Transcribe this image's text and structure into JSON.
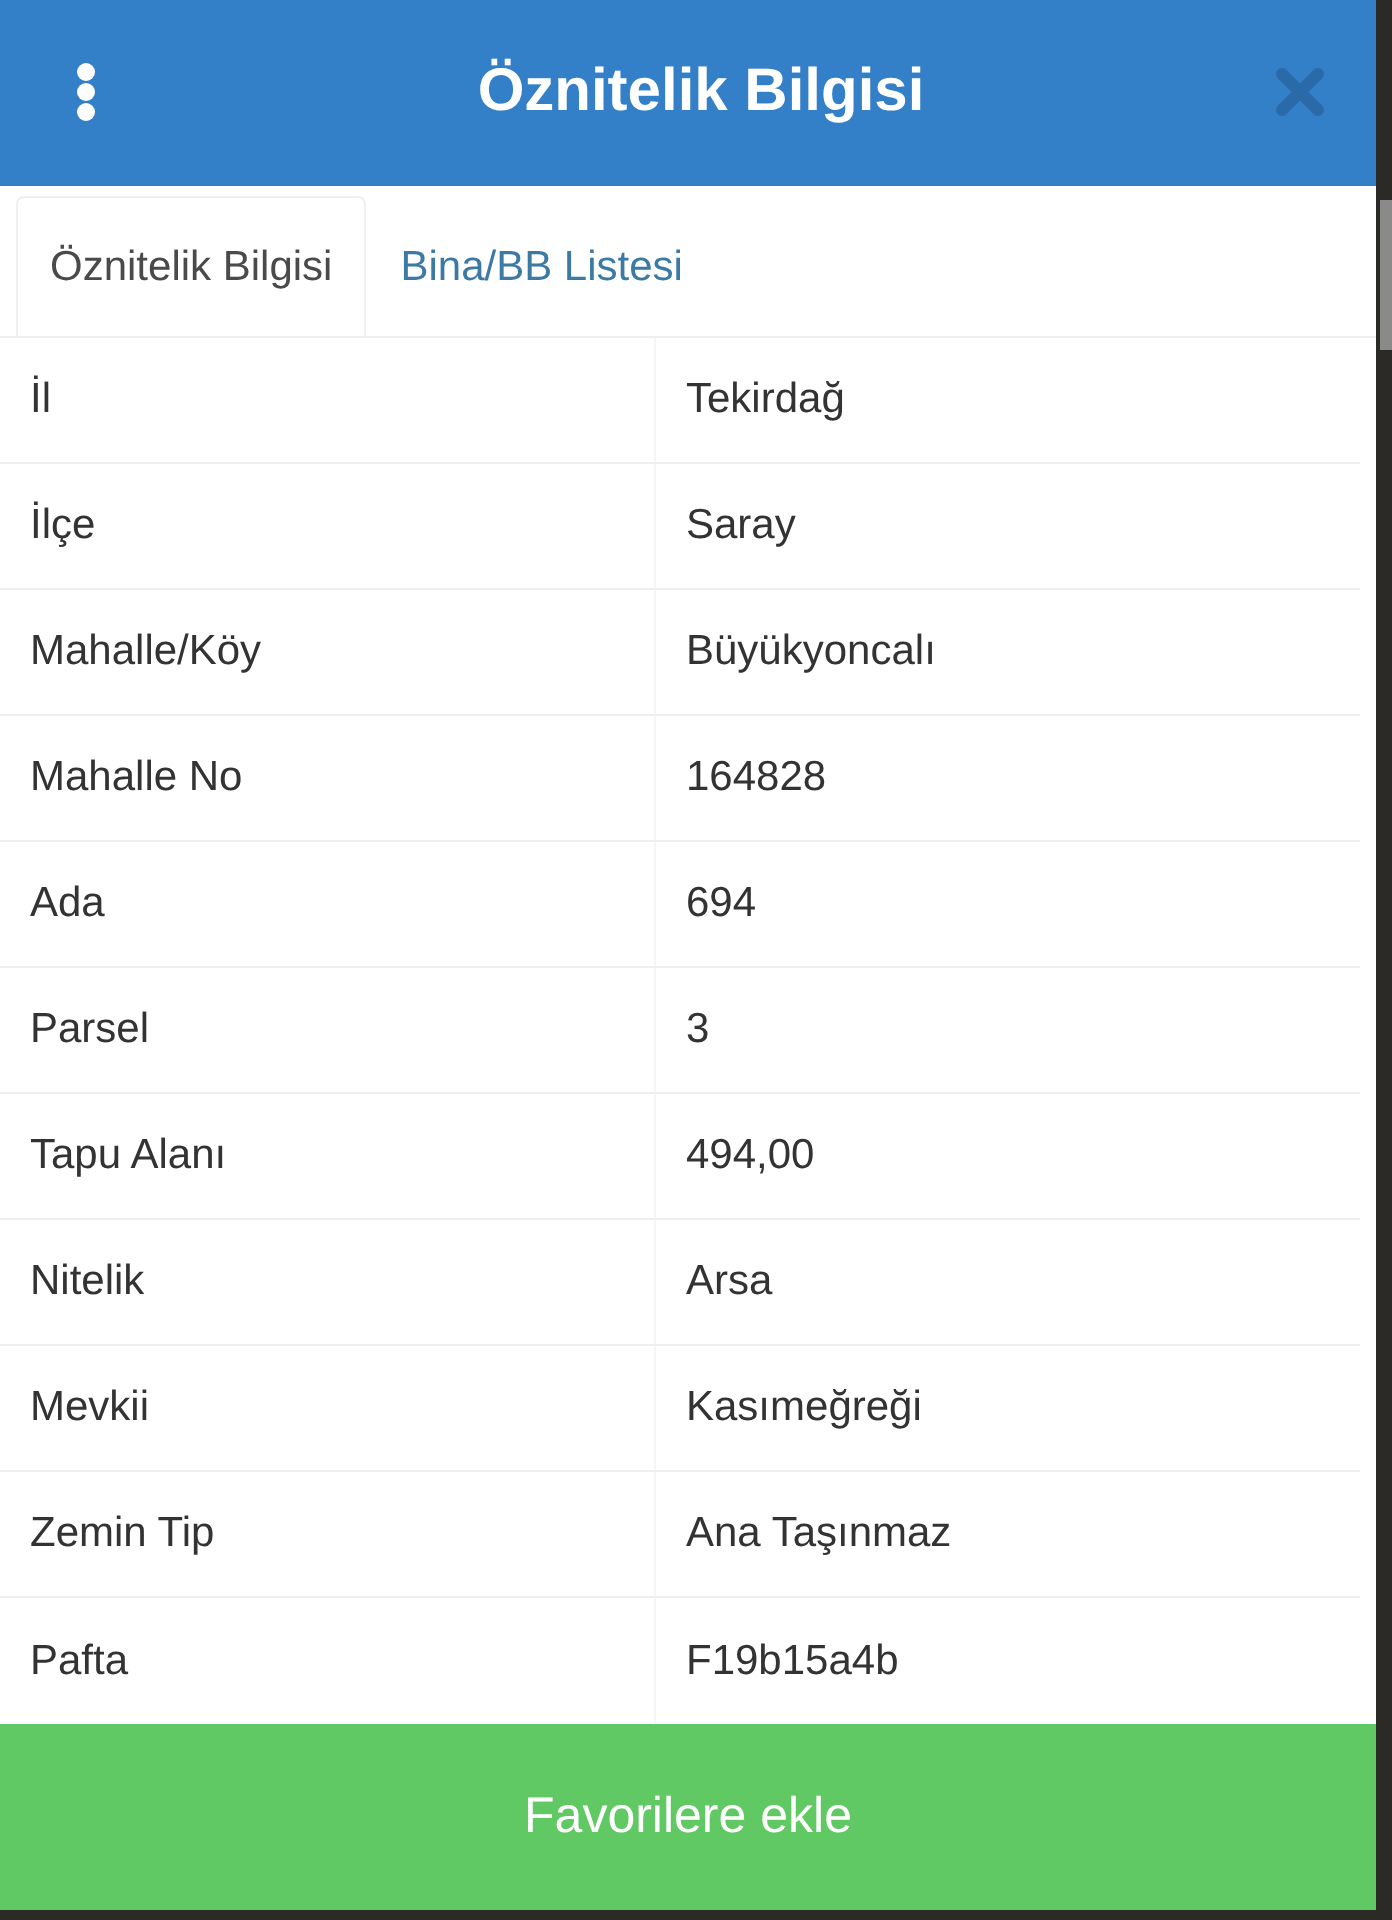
{
  "header": {
    "title": "Öznitelik Bilgisi"
  },
  "tabs": [
    {
      "label": "Öznitelik Bilgisi",
      "selected": true
    },
    {
      "label": "Bina/BB Listesi",
      "selected": false
    }
  ],
  "rows": [
    {
      "label": "İl",
      "value": "Tekirdağ"
    },
    {
      "label": "İlçe",
      "value": "Saray"
    },
    {
      "label": "Mahalle/Köy",
      "value": "Büyükyoncalı"
    },
    {
      "label": "Mahalle No",
      "value": "164828"
    },
    {
      "label": "Ada",
      "value": "694"
    },
    {
      "label": "Parsel",
      "value": "3"
    },
    {
      "label": "Tapu Alanı",
      "value": "494,00"
    },
    {
      "label": "Nitelik",
      "value": "Arsa"
    },
    {
      "label": "Mevkii",
      "value": "Kasımeğreği"
    },
    {
      "label": "Zemin Tip",
      "value": "Ana Taşınmaz"
    },
    {
      "label": "Pafta",
      "value": "F19b15a4b"
    }
  ],
  "button": {
    "label": "Favorilere ekle"
  }
}
